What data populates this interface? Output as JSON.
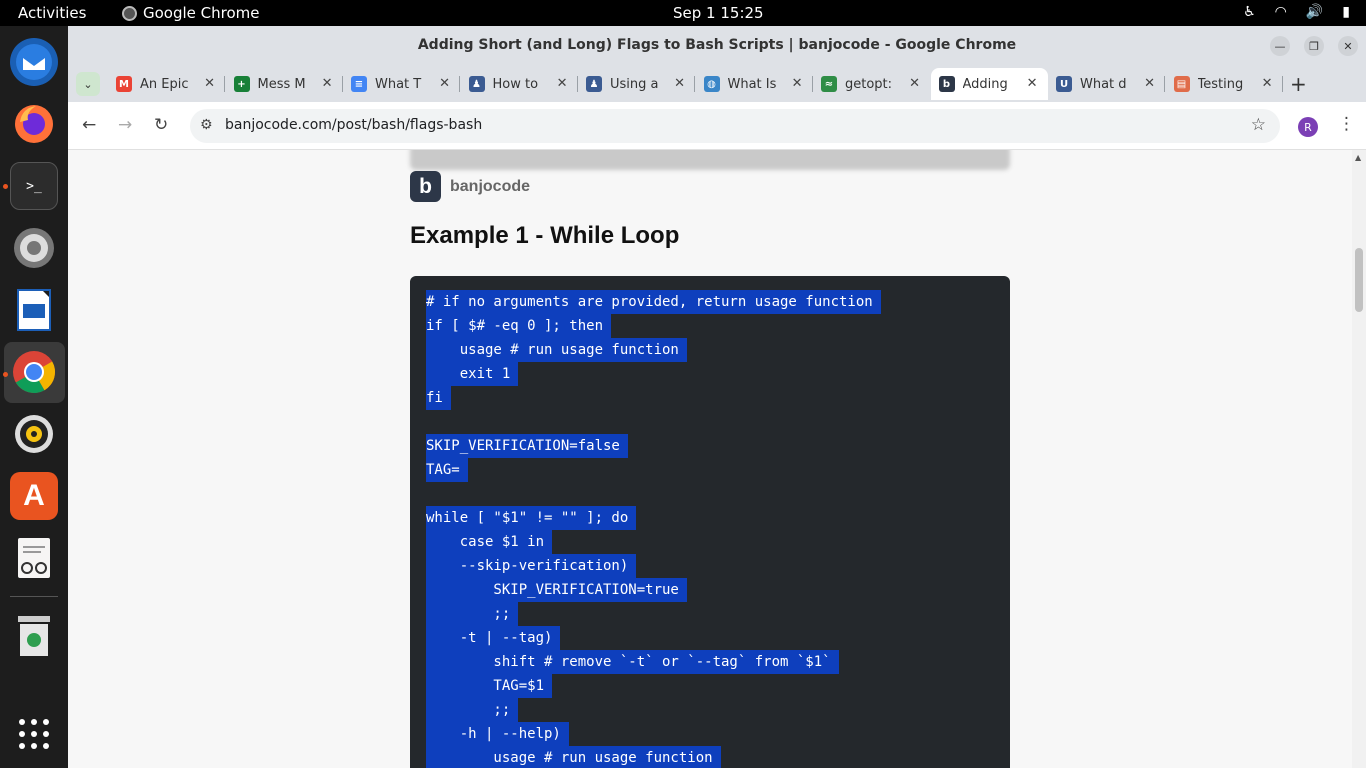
{
  "topbar": {
    "activities": "Activities",
    "app_name": "Google Chrome",
    "clock": "Sep 1  15:25"
  },
  "dock": {
    "items": [
      "thunderbird-icon",
      "firefox-icon",
      "terminal-icon",
      "settings-icon",
      "writer-icon",
      "chrome-icon",
      "rhythmbox-icon",
      "app-center-icon",
      "text-editor-icon",
      "trash-icon",
      "app-grid-icon"
    ]
  },
  "window": {
    "title": "Adding Short (and Long) Flags to Bash Scripts | banjocode - Google Chrome"
  },
  "tabs": [
    {
      "label": "An Epic",
      "favicon_color": "#ea4335",
      "glyph": "M"
    },
    {
      "label": "Mess M",
      "favicon_color": "#188038",
      "glyph": "+"
    },
    {
      "label": "What T",
      "favicon_color": "#4285f4",
      "glyph": "≡"
    },
    {
      "label": "How to",
      "favicon_color": "#3b5b92",
      "glyph": "♟"
    },
    {
      "label": "Using a",
      "favicon_color": "#3b5b92",
      "glyph": "♟"
    },
    {
      "label": "What Is",
      "favicon_color": "#3a86c8",
      "glyph": "◍"
    },
    {
      "label": "getopt:",
      "favicon_color": "#2f8d46",
      "glyph": "≈"
    },
    {
      "label": "Adding",
      "favicon_color": "#2d3748",
      "glyph": "b"
    },
    {
      "label": "What d",
      "favicon_color": "#3b5b92",
      "glyph": "U"
    },
    {
      "label": "Testing",
      "favicon_color": "#e06c4a",
      "glyph": "▤"
    }
  ],
  "active_tab_index": 7,
  "toolbar": {
    "url": "banjocode.com/post/bash/flags-bash",
    "profile_initial": "R"
  },
  "page": {
    "brand": "banjocode",
    "brand_logo": "b",
    "heading": "Example 1 - While Loop",
    "code_lines": [
      "# if no arguments are provided, return usage function",
      "if [ $# -eq 0 ]; then",
      "    usage # run usage function",
      "    exit 1",
      "fi",
      "",
      "SKIP_VERIFICATION=false",
      "TAG=",
      "",
      "while [ \"$1\" != \"\" ]; do",
      "    case $1 in",
      "    --skip-verification)",
      "        SKIP_VERIFICATION=true",
      "        ;;",
      "    -t | --tag)",
      "        shift # remove `-t` or `--tag` from `$1`",
      "        TAG=$1",
      "        ;;",
      "    -h | --help)",
      "        usage # run usage function"
    ]
  }
}
